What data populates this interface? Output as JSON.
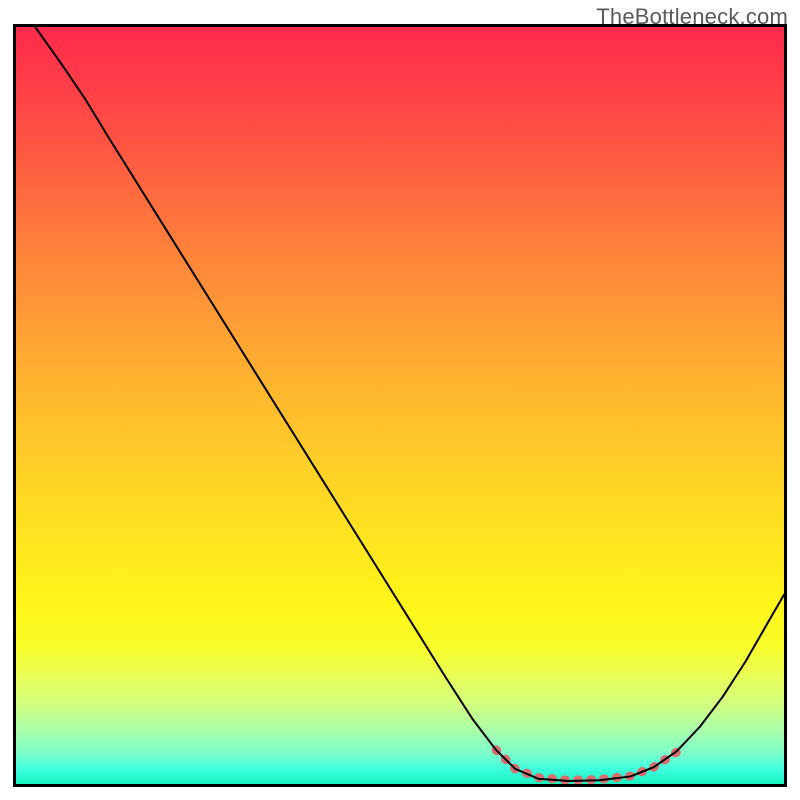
{
  "watermark": "TheBottleneck.com",
  "chart_data": {
    "type": "line",
    "title": "",
    "xlabel": "",
    "ylabel": "",
    "xlim": [
      0,
      100
    ],
    "ylim": [
      0,
      100
    ],
    "grid": false,
    "series": [
      {
        "name": "curve",
        "color": "#000000",
        "width": 2,
        "points": [
          {
            "x": 2.5,
            "y": 100
          },
          {
            "x": 6,
            "y": 95
          },
          {
            "x": 9,
            "y": 90.5
          },
          {
            "x": 12,
            "y": 85.5
          },
          {
            "x": 16,
            "y": 79
          },
          {
            "x": 20,
            "y": 72.5
          },
          {
            "x": 24,
            "y": 66
          },
          {
            "x": 28,
            "y": 59.5
          },
          {
            "x": 32,
            "y": 53
          },
          {
            "x": 36,
            "y": 46.5
          },
          {
            "x": 40,
            "y": 40
          },
          {
            "x": 44,
            "y": 33.5
          },
          {
            "x": 48,
            "y": 27
          },
          {
            "x": 52,
            "y": 20.5
          },
          {
            "x": 56,
            "y": 14
          },
          {
            "x": 59.5,
            "y": 8.5
          },
          {
            "x": 62.5,
            "y": 4.5
          },
          {
            "x": 65,
            "y": 2
          },
          {
            "x": 68,
            "y": 0.7
          },
          {
            "x": 72,
            "y": 0.4
          },
          {
            "x": 76,
            "y": 0.5
          },
          {
            "x": 80,
            "y": 1
          },
          {
            "x": 83,
            "y": 2.2
          },
          {
            "x": 86,
            "y": 4.3
          },
          {
            "x": 89,
            "y": 7.5
          },
          {
            "x": 92,
            "y": 11.5
          },
          {
            "x": 95,
            "y": 16.2
          },
          {
            "x": 98,
            "y": 21.5
          },
          {
            "x": 100,
            "y": 25
          }
        ]
      },
      {
        "name": "optimal-zone",
        "color": "#D86E6F",
        "width": 8,
        "points": [
          {
            "x": 62.5,
            "y": 4.5
          },
          {
            "x": 65,
            "y": 2
          },
          {
            "x": 68,
            "y": 0.85
          },
          {
            "x": 72,
            "y": 0.5
          },
          {
            "x": 76,
            "y": 0.6
          },
          {
            "x": 80,
            "y": 1.05
          },
          {
            "x": 83,
            "y": 2.2
          },
          {
            "x": 86,
            "y": 4.2
          }
        ]
      }
    ]
  }
}
